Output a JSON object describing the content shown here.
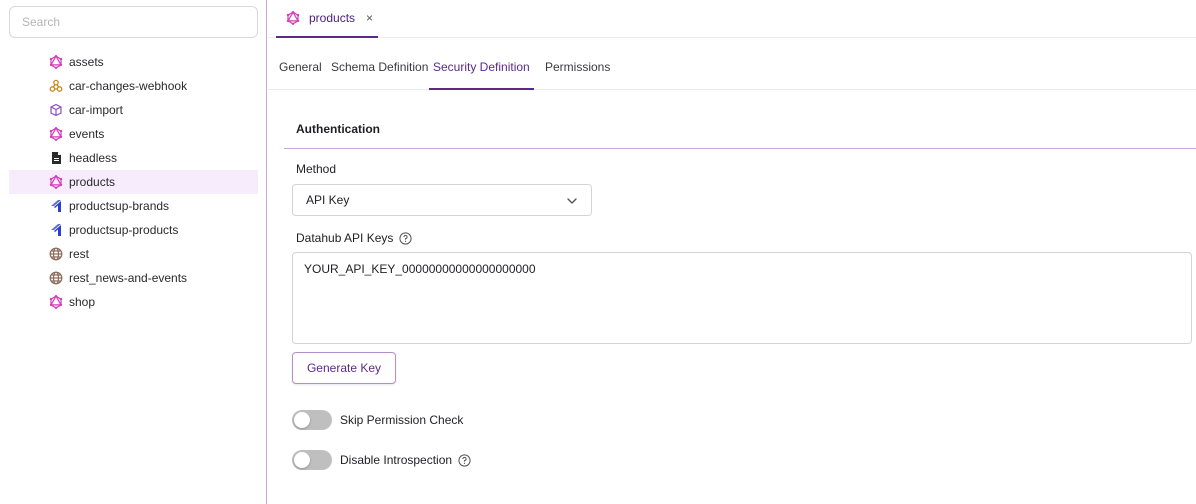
{
  "sidebar": {
    "search_placeholder": "Search",
    "items": [
      {
        "label": "assets",
        "icon": "graphql-icon",
        "selected": false
      },
      {
        "label": "car-changes-webhook",
        "icon": "webhook-icon",
        "selected": false
      },
      {
        "label": "car-import",
        "icon": "import-cube-icon",
        "selected": false
      },
      {
        "label": "events",
        "icon": "graphql-icon",
        "selected": false
      },
      {
        "label": "headless",
        "icon": "file-icon",
        "selected": false
      },
      {
        "label": "products",
        "icon": "graphql-icon",
        "selected": true
      },
      {
        "label": "productsup-brands",
        "icon": "productsup-icon",
        "selected": false
      },
      {
        "label": "productsup-products",
        "icon": "productsup-icon",
        "selected": false
      },
      {
        "label": "rest",
        "icon": "globe-icon",
        "selected": false
      },
      {
        "label": "rest_news-and-events",
        "icon": "globe-icon",
        "selected": false
      },
      {
        "label": "shop",
        "icon": "graphql-icon",
        "selected": false
      }
    ]
  },
  "doc_tab": {
    "label": "products",
    "icon": "graphql-icon",
    "close": "×"
  },
  "sub_tabs": [
    {
      "label": "General",
      "active": false
    },
    {
      "label": "Schema Definition",
      "active": false
    },
    {
      "label": "Security Definition",
      "active": true
    },
    {
      "label": "Permissions",
      "active": false
    }
  ],
  "auth": {
    "section_title": "Authentication",
    "method_label": "Method",
    "method_value": "API Key",
    "keys_label": "Datahub API Keys",
    "keys_value": "YOUR_API_KEY_00000000000000000000",
    "generate_button": "Generate Key",
    "skip_permission_label": "Skip Permission Check",
    "skip_permission_on": false,
    "disable_introspection_label": "Disable Introspection",
    "disable_introspection_on": false
  },
  "colors": {
    "accent": "#5b2a86",
    "graphql": "#d63fb7",
    "webhook": "#c88a1e",
    "import": "#8a4fc6",
    "productsup": "#2c3fd1",
    "globe": "#8b6a5a",
    "file": "#2a2a2e",
    "selected_bg": "#f6ecfb",
    "toggle_off": "#bfbfbf"
  }
}
